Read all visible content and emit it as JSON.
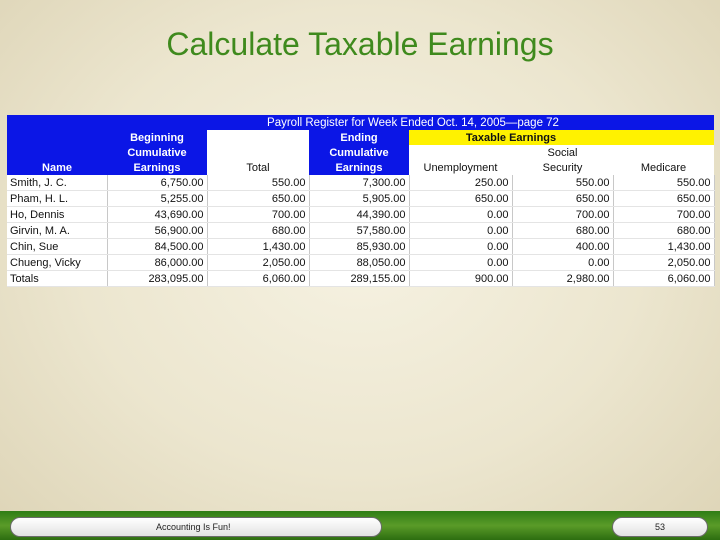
{
  "slide": {
    "title": "Calculate Taxable Earnings",
    "footer_text": "Accounting Is Fun!",
    "page_number": "53"
  },
  "table": {
    "caption": "Payroll Register for Week Ended Oct. 14, 2005—page 72",
    "headers": {
      "name": "Name",
      "beginning": "Beginning Cumulative Earnings",
      "total": "Total",
      "ending": "Ending Cumulative Earnings",
      "taxable_group": "Taxable Earnings",
      "unemployment": "Unemployment",
      "social_security": "Social Security",
      "medicare": "Medicare"
    },
    "rows": [
      {
        "name": "Smith, J. C.",
        "beginning": "6,750.00",
        "total": "550.00",
        "ending": "7,300.00",
        "unemployment": "250.00",
        "social": "550.00",
        "medicare": "550.00"
      },
      {
        "name": "Pham, H. L.",
        "beginning": "5,255.00",
        "total": "650.00",
        "ending": "5,905.00",
        "unemployment": "650.00",
        "social": "650.00",
        "medicare": "650.00"
      },
      {
        "name": "Ho, Dennis",
        "beginning": "43,690.00",
        "total": "700.00",
        "ending": "44,390.00",
        "unemployment": "0.00",
        "social": "700.00",
        "medicare": "700.00"
      },
      {
        "name": "Girvin, M. A.",
        "beginning": "56,900.00",
        "total": "680.00",
        "ending": "57,580.00",
        "unemployment": "0.00",
        "social": "680.00",
        "medicare": "680.00"
      },
      {
        "name": "Chin, Sue",
        "beginning": "84,500.00",
        "total": "1,430.00",
        "ending": "85,930.00",
        "unemployment": "0.00",
        "social": "400.00",
        "medicare": "1,430.00"
      },
      {
        "name": "Chueng, Vicky",
        "beginning": "86,000.00",
        "total": "2,050.00",
        "ending": "88,050.00",
        "unemployment": "0.00",
        "social": "0.00",
        "medicare": "2,050.00"
      }
    ],
    "totals": {
      "label": "Totals",
      "beginning": "283,095.00",
      "total": "6,060.00",
      "ending": "289,155.00",
      "unemployment": "900.00",
      "social": "2,980.00",
      "medicare": "6,060.00"
    }
  },
  "colors": {
    "title": "#3f8a1d",
    "header_blue": "#0b16e6",
    "taxable_yellow": "#fff200",
    "footer_green": "#4a8f1f"
  }
}
